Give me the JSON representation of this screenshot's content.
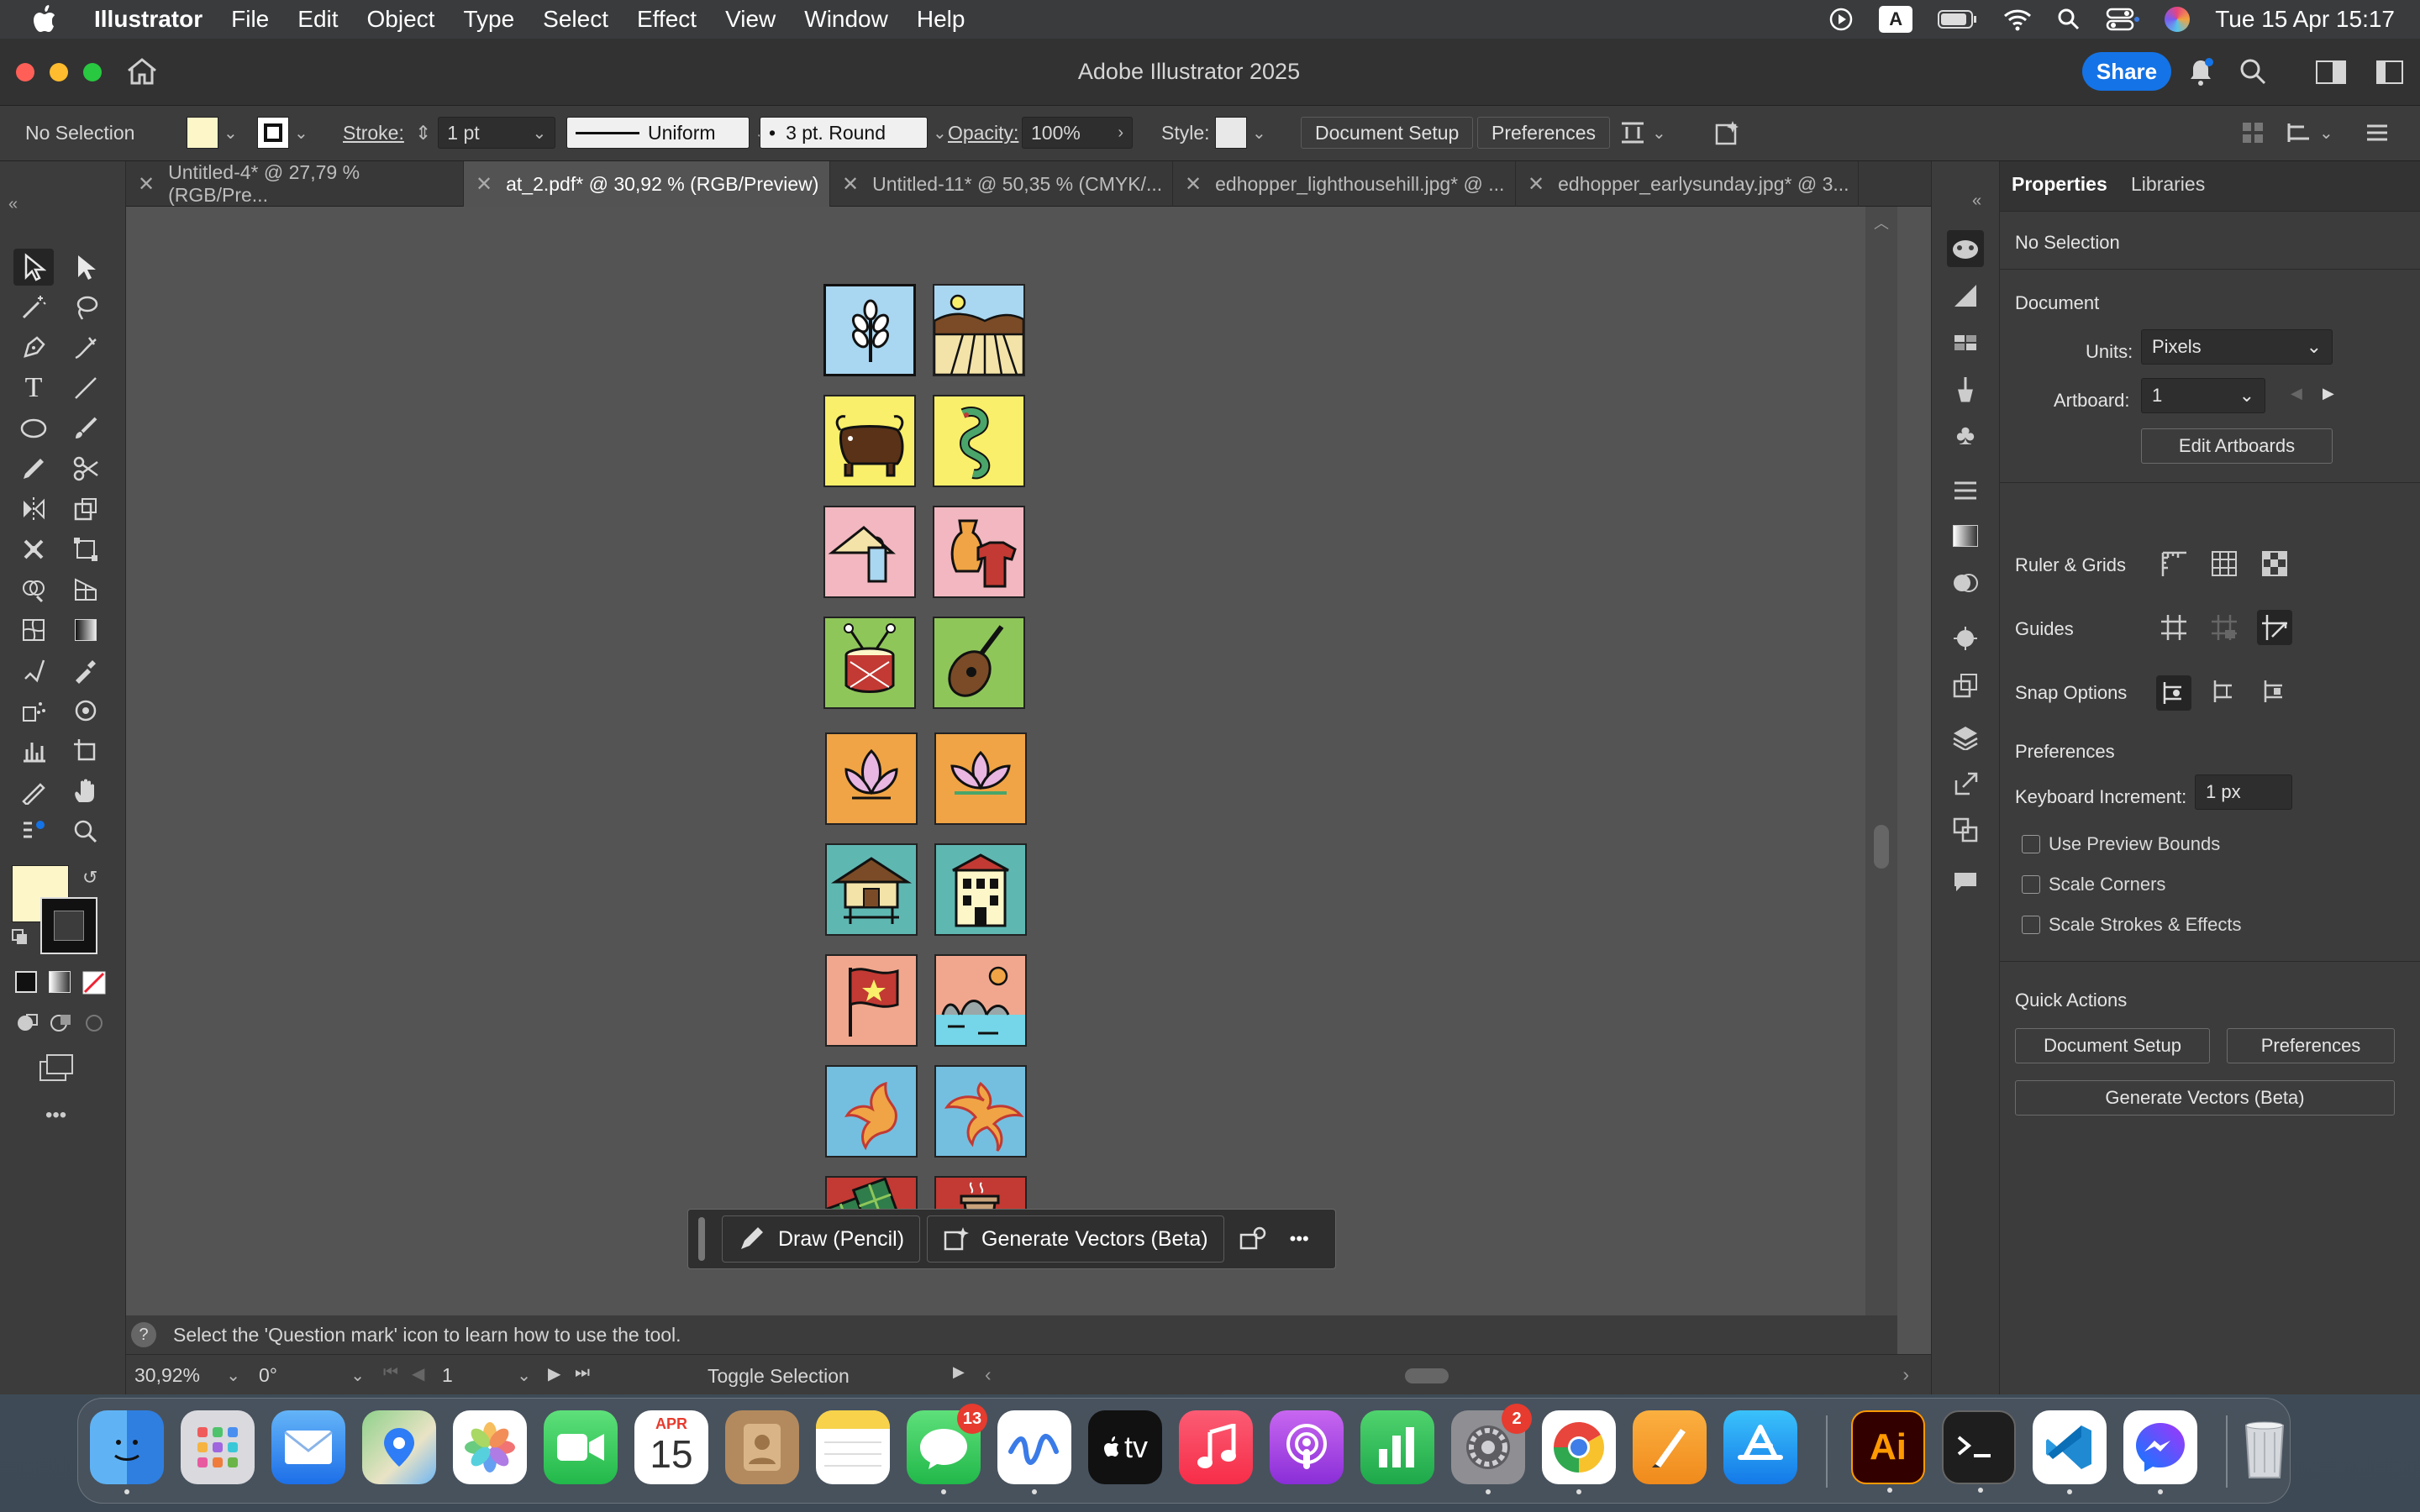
{
  "menubar": {
    "app_name": "Illustrator",
    "items": [
      "File",
      "Edit",
      "Object",
      "Type",
      "Select",
      "Effect",
      "View",
      "Window",
      "Help"
    ],
    "input_indicator": "A",
    "datetime": "Tue 15 Apr  15:17"
  },
  "window": {
    "title": "Adobe Illustrator 2025",
    "share_label": "Share"
  },
  "control_bar": {
    "selection": "No Selection",
    "stroke_label": "Stroke:",
    "stroke_value": "1 pt",
    "profile_value": "Uniform",
    "brush_value": "3 pt. Round",
    "opacity_label": "Opacity:",
    "opacity_value": "100%",
    "style_label": "Style:",
    "document_setup": "Document Setup",
    "preferences": "Preferences"
  },
  "tabs": [
    {
      "label": "Untitled-4* @ 27,79 % (RGB/Pre..."
    },
    {
      "label": "at_2.pdf* @ 30,92 % (RGB/Preview)"
    },
    {
      "label": "Untitled-11* @ 50,35 % (CMYK/..."
    },
    {
      "label": "edhopper_lighthousehill.jpg* @ ..."
    },
    {
      "label": "edhopper_earlysunday.jpg* @ 3..."
    }
  ],
  "floating_bar": {
    "draw_label": "Draw (Pencil)",
    "generate_label": "Generate Vectors (Beta)",
    "more": "•••"
  },
  "status": {
    "hint": "Select the 'Question mark' icon to learn how to use the tool.",
    "zoom": "30,92%",
    "rotation": "0°",
    "artboard": "1",
    "toggle": "Toggle Selection"
  },
  "toolbar_more": "•••",
  "properties": {
    "tab_properties": "Properties",
    "tab_libraries": "Libraries",
    "selection": "No Selection",
    "document_heading": "Document",
    "units_label": "Units:",
    "units_value": "Pixels",
    "artboard_label": "Artboard:",
    "artboard_value": "1",
    "edit_artboards": "Edit Artboards",
    "ruler_grids": "Ruler & Grids",
    "guides": "Guides",
    "snap_options": "Snap Options",
    "preferences_heading": "Preferences",
    "keyboard_increment_label": "Keyboard Increment:",
    "keyboard_increment_value": "1 px",
    "use_preview_bounds": "Use Preview Bounds",
    "scale_corners": "Scale Corners",
    "scale_strokes": "Scale Strokes & Effects",
    "quick_actions": "Quick Actions",
    "qa_document_setup": "Document Setup",
    "qa_preferences": "Preferences",
    "qa_generate_vectors": "Generate Vectors (Beta)"
  },
  "dock": {
    "calendar_month": "APR",
    "calendar_day": "15",
    "messages_badge": "13",
    "settings_badge": "2",
    "tv_label": "tv",
    "ai_label": "Ai"
  },
  "colors": {
    "accent": "#1473e6",
    "fill_swatch": "#fdf6c8",
    "tile_blue": "#a9d6f0",
    "tile_yellow": "#f9ef6a",
    "tile_pink": "#f2b7c0",
    "tile_green": "#8fc65a",
    "tile_orange": "#f0a445",
    "tile_teal": "#5fb7b2",
    "tile_salmon": "#f1a78e",
    "tile_sky": "#74bfe0",
    "tile_red": "#c23a33"
  }
}
